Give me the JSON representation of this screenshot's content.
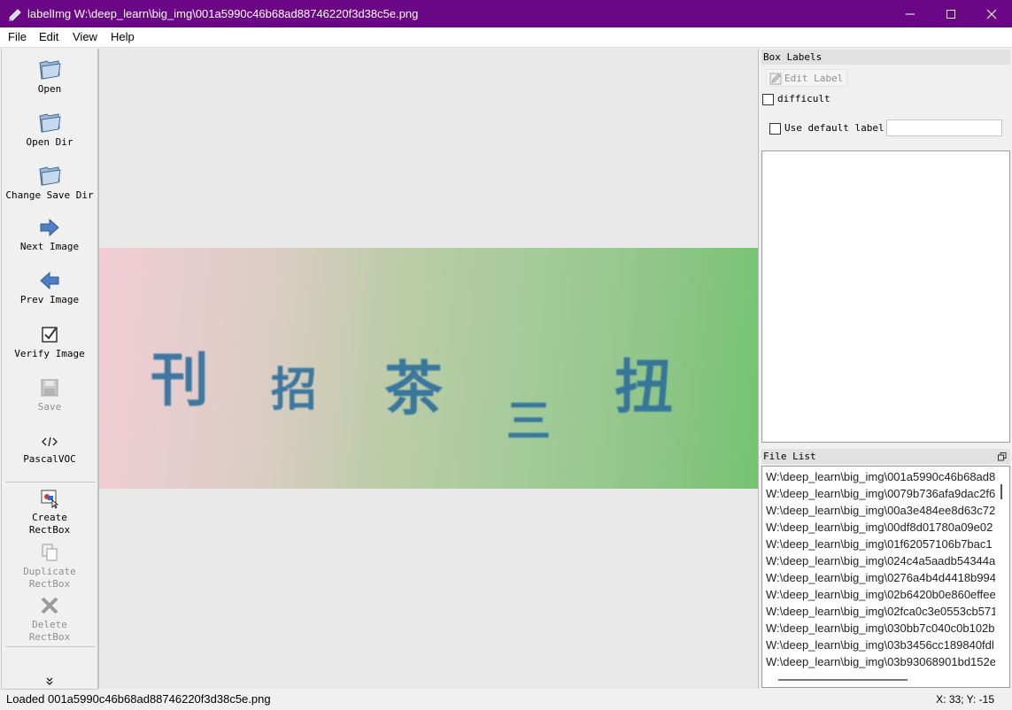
{
  "window": {
    "title": "labelImg W:\\deep_learn\\big_img\\001a5990c46b68ad88746220f3d38c5e.png",
    "accent_color": "#6b0687"
  },
  "menu": {
    "file": "File",
    "edit": "Edit",
    "view": "View",
    "help": "Help"
  },
  "toolbar": {
    "open": "Open",
    "open_dir": "Open Dir",
    "change_save_dir": "Change Save Dir",
    "next_image": "Next Image",
    "prev_image": "Prev Image",
    "verify_image": "Verify Image",
    "save": "Save",
    "format": "PascalVOC",
    "create_rectbox_1": "Create",
    "create_rectbox_2": "RectBox",
    "duplicate_rectbox_1": "Duplicate",
    "duplicate_rectbox_2": "RectBox",
    "delete_rectbox_1": "Delete",
    "delete_rectbox_2": "RectBox",
    "more_icon": "chevron-double-down"
  },
  "image": {
    "chars": [
      "刊",
      "招",
      "茶",
      "三",
      "扭"
    ]
  },
  "box_labels": {
    "title": "Box Labels",
    "edit_label": "Edit Label",
    "difficult": "difficult",
    "use_default_label": "Use default label",
    "default_label_value": ""
  },
  "file_list": {
    "title": "File List",
    "files": [
      "W:\\deep_learn\\big_img\\001a5990c46b68ad8",
      "W:\\deep_learn\\big_img\\0079b736afa9dac2f6",
      "W:\\deep_learn\\big_img\\00a3e484ee8d63c72",
      "W:\\deep_learn\\big_img\\00df8d01780a09e02",
      "W:\\deep_learn\\big_img\\01f62057106b7bac1",
      "W:\\deep_learn\\big_img\\024c4a5aadb54344a",
      "W:\\deep_learn\\big_img\\0276a4b4d4418b994",
      "W:\\deep_learn\\big_img\\02b6420b0e860effee",
      "W:\\deep_learn\\big_img\\02fca0c3e0553cb571",
      "W:\\deep_learn\\big_img\\030bb7c040c0b102b",
      "W:\\deep_learn\\big_img\\03b3456cc189840fdl",
      "W:\\deep_learn\\big_img\\03b93068901bd152e"
    ]
  },
  "status": {
    "message": "Loaded 001a5990c46b68ad88746220f3d38c5e.png",
    "coords": "X: 33; Y: -15"
  }
}
